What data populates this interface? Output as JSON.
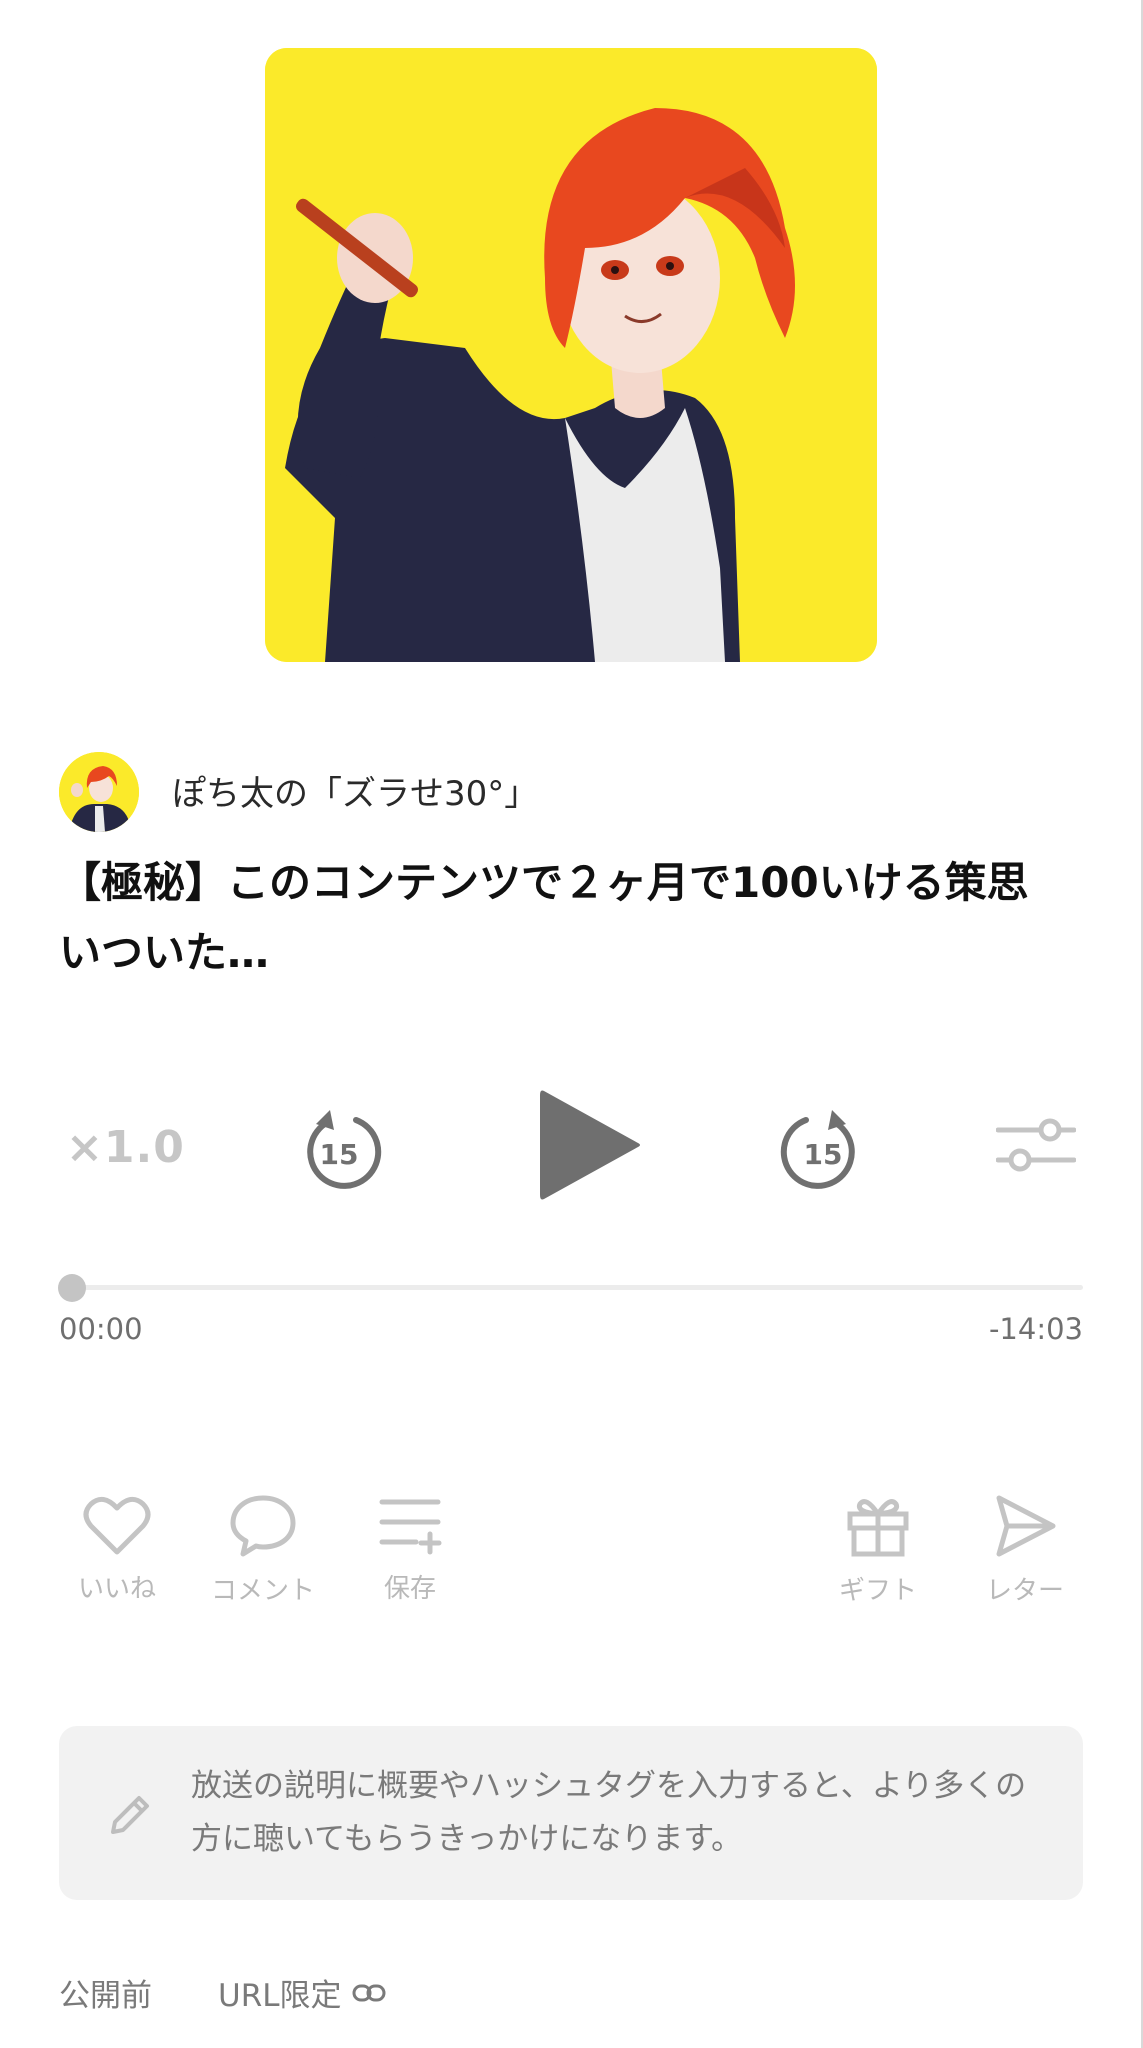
{
  "cover": {
    "icon": "anime-character-cover-art"
  },
  "channel": {
    "name": "ぽち太の「ズラせ30°」"
  },
  "episode": {
    "title": "【極秘】このコンテンツで２ヶ月で100いける策思いついた…"
  },
  "player": {
    "speed": "×1.0",
    "skip_back": "15",
    "skip_forward": "15",
    "current_time": "00:00",
    "remaining_time": "-14:03",
    "progress": 0
  },
  "actions": {
    "like": "いいね",
    "comment": "コメント",
    "save": "保存",
    "gift": "ギフト",
    "letter": "レター"
  },
  "description": {
    "placeholder": "放送の説明に概要やハッシュタグを入力すると、より多くの方に聴いてもらうきっかけになります。"
  },
  "footer": {
    "status": "公開前",
    "visibility": "URL限定"
  },
  "colors": {
    "cover_bg": "#fbea2a",
    "icon_gray": "#c4c4c4",
    "play_gray": "#6f6f6f"
  }
}
